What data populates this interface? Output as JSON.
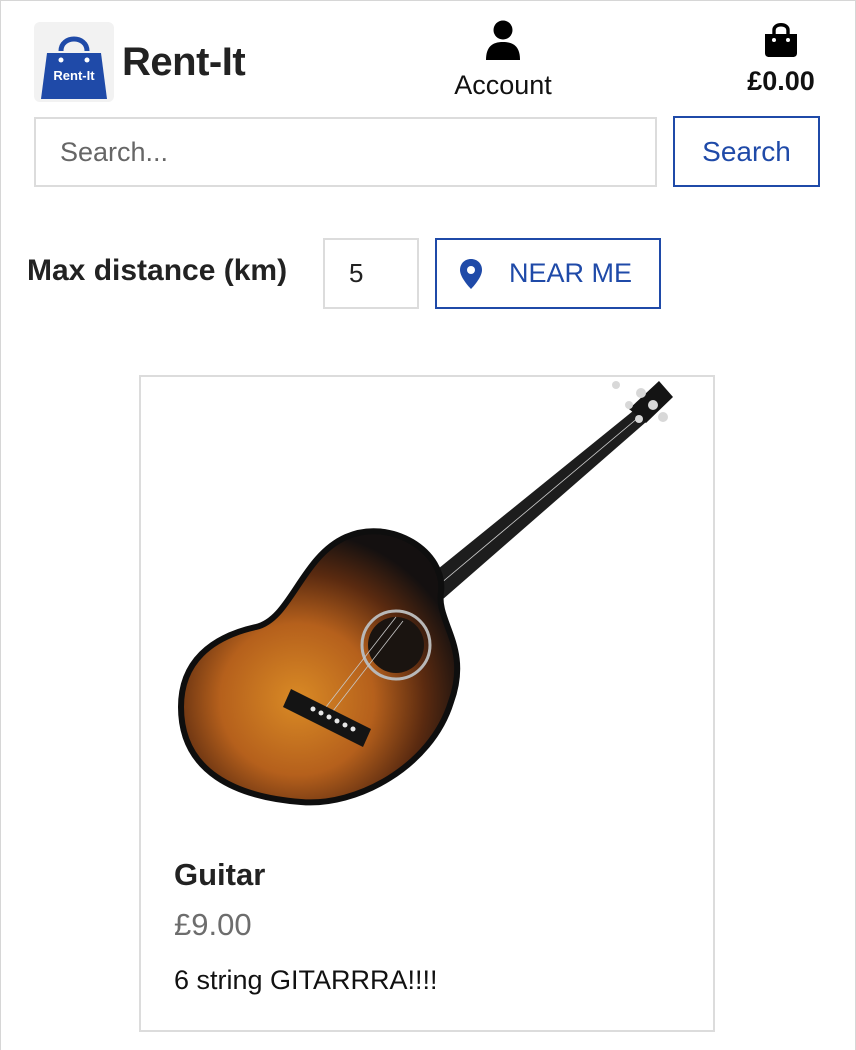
{
  "brand": {
    "name": "Rent-It",
    "logo_text": "Rent-It",
    "logo_color": "#1f4aa8"
  },
  "header": {
    "account_label": "Account",
    "cart_total": "£0.00"
  },
  "search": {
    "placeholder": "Search...",
    "value": "",
    "button_label": "Search"
  },
  "filters": {
    "distance_label": "Max distance (km)",
    "distance_value": "5",
    "near_me_label": "NEAR ME"
  },
  "products": [
    {
      "name": "Guitar",
      "price": "£9.00",
      "description": "6 string GITARRRA!!!!"
    }
  ],
  "colors": {
    "accent": "#1f4aa8",
    "price": "#6d6d6d"
  },
  "icons": {
    "account": "user-icon",
    "cart": "shopping-bag-icon",
    "near_me": "map-pin-icon"
  }
}
